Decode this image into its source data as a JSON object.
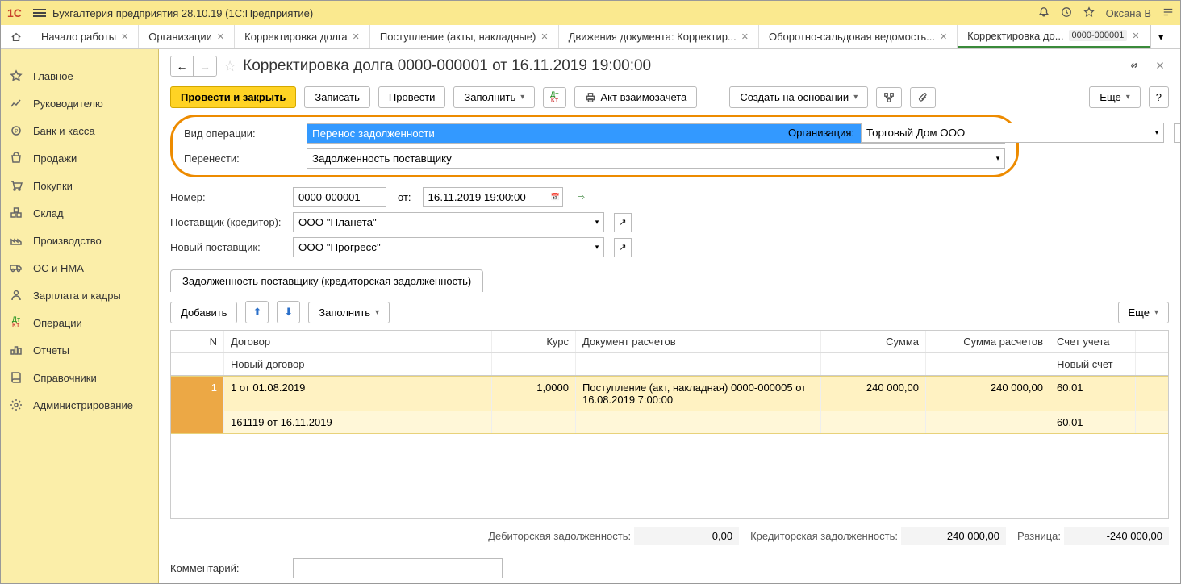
{
  "app": {
    "title": "Бухгалтерия предприятия 28.10.19  (1С:Предприятие)",
    "user": "Оксана В"
  },
  "tabs": [
    {
      "label": "Начало работы"
    },
    {
      "label": "Организации"
    },
    {
      "label": "Корректировка долга"
    },
    {
      "label": "Поступление (акты, накладные)"
    },
    {
      "label": "Движения документа: Корректир..."
    },
    {
      "label": "Оборотно-сальдовая ведомость..."
    },
    {
      "label_a": "Корректировка до...",
      "label_b": "0000-000001",
      "active": true
    }
  ],
  "sidebar": [
    {
      "label": "Главное"
    },
    {
      "label": "Руководителю"
    },
    {
      "label": "Банк и касса"
    },
    {
      "label": "Продажи"
    },
    {
      "label": "Покупки"
    },
    {
      "label": "Склад"
    },
    {
      "label": "Производство"
    },
    {
      "label": "ОС и НМА"
    },
    {
      "label": "Зарплата и кадры"
    },
    {
      "label": "Операции"
    },
    {
      "label": "Отчеты"
    },
    {
      "label": "Справочники"
    },
    {
      "label": "Администрирование"
    }
  ],
  "doc": {
    "title": "Корректировка долга 0000-000001 от 16.11.2019 19:00:00",
    "toolbar": {
      "post_close": "Провести и закрыть",
      "save": "Записать",
      "post": "Провести",
      "fill": "Заполнить",
      "act": "Акт взаимозачета",
      "create_based": "Создать на основании",
      "more": "Еще"
    },
    "fields": {
      "operation_label": "Вид операции:",
      "operation_value": "Перенос задолженности",
      "transfer_label": "Перенести:",
      "transfer_value": "Задолженность поставщику",
      "org_label": "Организация:",
      "org_value": "Торговый Дом ООО",
      "number_label": "Номер:",
      "number_value": "0000-000001",
      "from_label": "от:",
      "date_value": "16.11.2019 19:00:00",
      "supplier_label": "Поставщик (кредитор):",
      "supplier_value": "ООО \"Планета\"",
      "new_supplier_label": "Новый поставщик:",
      "new_supplier_value": "ООО \"Прогресс\""
    },
    "tabpanel": {
      "tab_label": "Задолженность поставщику (кредиторская задолженность)",
      "add": "Добавить",
      "fill": "Заполнить",
      "more": "Еще"
    },
    "grid": {
      "headers": {
        "n": "N",
        "dogovor": "Договор",
        "new_dogovor": "Новый договор",
        "kurs": "Курс",
        "doc": "Документ расчетов",
        "sum": "Сумма",
        "sum_r": "Сумма расчетов",
        "account": "Счет учета",
        "new_account": "Новый счет"
      },
      "rows": [
        {
          "n": "1",
          "dogovor": "1 от 01.08.2019",
          "new_dogovor": "161119 от 16.11.2019",
          "kurs": "1,0000",
          "doc": "Поступление (акт, накладная) 0000-000005 от 16.08.2019 7:00:00",
          "sum": "240 000,00",
          "sum_r": "240 000,00",
          "account": "60.01",
          "new_account": "60.01"
        }
      ]
    },
    "totals": {
      "deb_label": "Дебиторская задолженность:",
      "deb_value": "0,00",
      "cred_label": "Кредиторская задолженность:",
      "cred_value": "240 000,00",
      "diff_label": "Разница:",
      "diff_value": "-240 000,00"
    },
    "comment_label": "Комментарий:",
    "comment_value": ""
  }
}
